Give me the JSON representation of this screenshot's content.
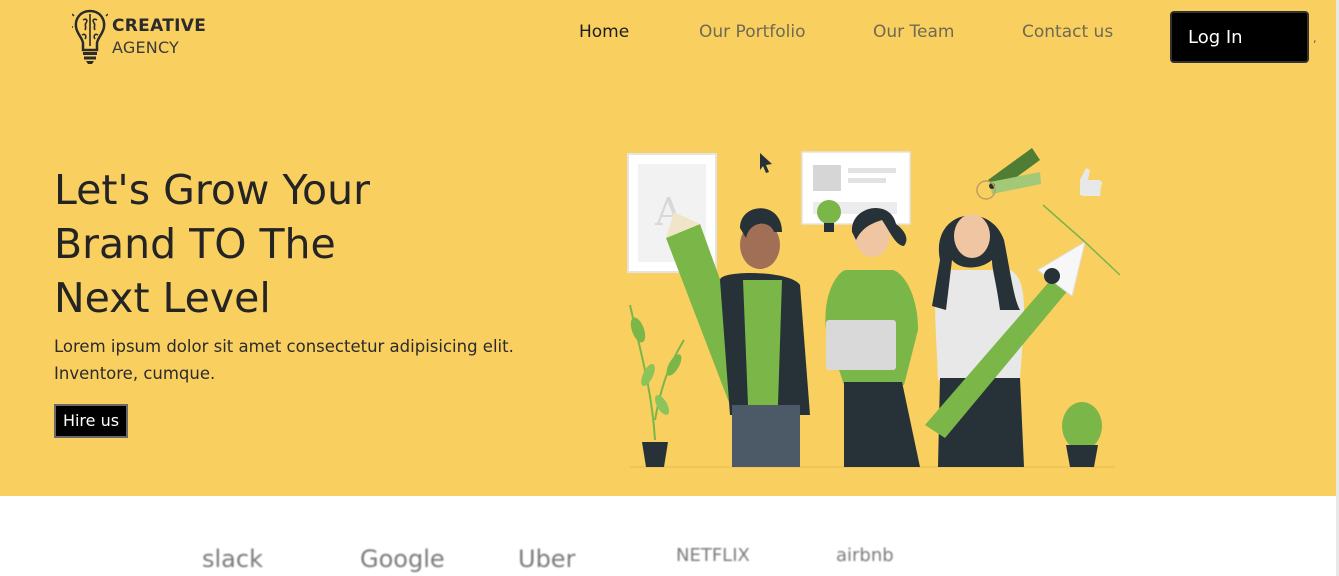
{
  "header": {
    "logo": {
      "line1": "CREATIVE",
      "line2": "AGENCY",
      "icon": "lightbulb-brain-icon"
    },
    "nav": [
      {
        "label": "Home",
        "active": true
      },
      {
        "label": "Our Portfolio",
        "active": false
      },
      {
        "label": "Our Team",
        "active": false
      },
      {
        "label": "Contact us",
        "active": false
      }
    ],
    "login_label": "Log In",
    "stray_text": ","
  },
  "hero": {
    "headline_lines": [
      "Let's Grow Your",
      "Brand TO The",
      "Next Level"
    ],
    "subtext": "Lorem ipsum dolor sit amet consectetur adipisicing elit. Inventore, cumque.",
    "cta_label": "Hire us",
    "illustration": "team-with-design-tools-illustration"
  },
  "brands": [
    "slack",
    "Google",
    "Uber",
    "NETFLIX",
    "airbnb"
  ],
  "colors": {
    "hero_background": "#F9CF5F",
    "button_background": "#000000",
    "illustration_green": "#7AB648",
    "text_dark": "#242424"
  }
}
